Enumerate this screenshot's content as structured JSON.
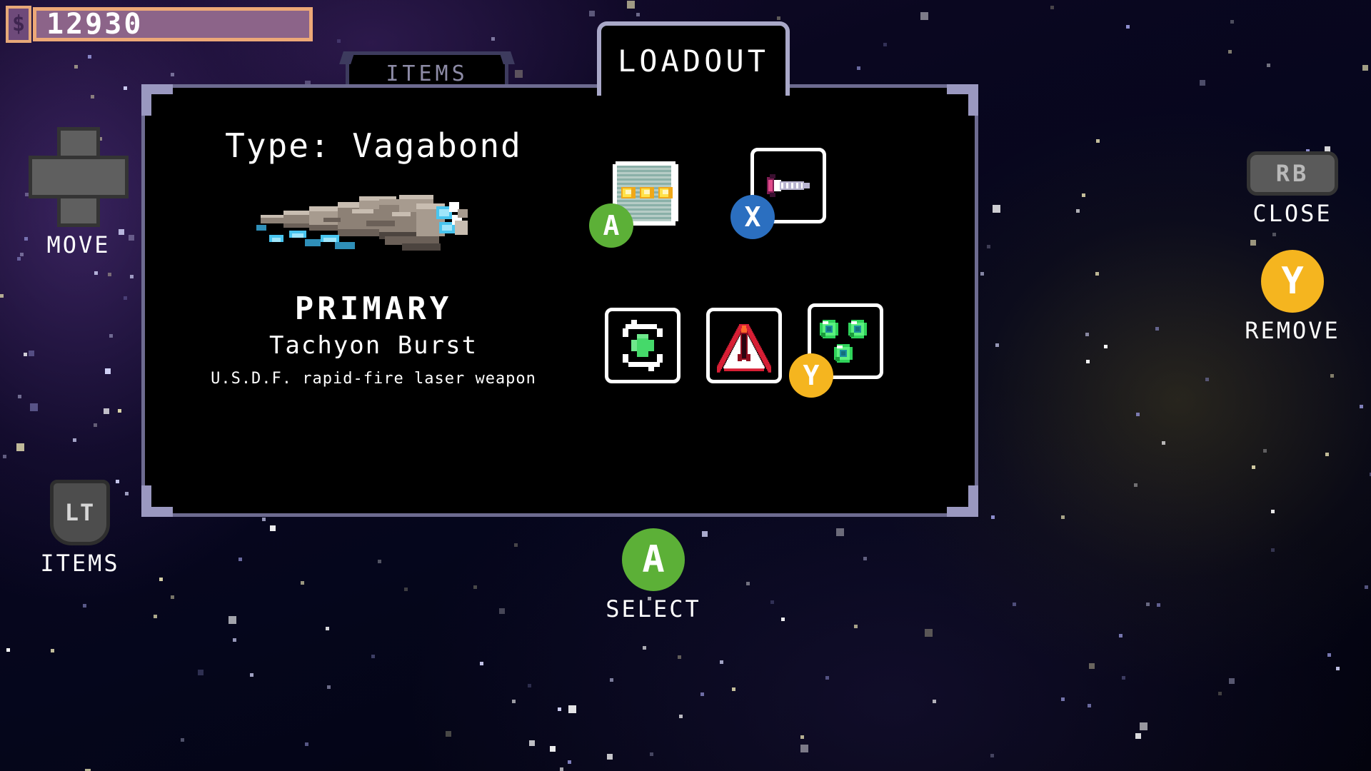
{
  "hud": {
    "currency": {
      "icon": "coin-icon",
      "symbol": "$",
      "value": "12930"
    }
  },
  "tabs": [
    {
      "id": "items",
      "label": "ITEMS",
      "active": false
    },
    {
      "id": "loadout",
      "label": "LOADOUT",
      "active": true
    }
  ],
  "panel": {
    "ship": {
      "type_line": "Type: Vagabond",
      "sprite": "vagabond-ship-sprite"
    },
    "primary": {
      "slot_label": "PRIMARY",
      "weapon_name": "Tachyon Burst",
      "description": "U.S.D.F. rapid-fire laser weapon"
    },
    "slots": [
      {
        "id": "slot-1",
        "icon": "ammo-crate-icon",
        "badge": "A",
        "badge_color": "#5cb037",
        "filled": true,
        "bordered": false
      },
      {
        "id": "slot-2",
        "icon": "ship-module-icon",
        "badge": "X",
        "badge_color": "#2b6fc0",
        "filled": true,
        "bordered": true
      },
      {
        "id": "slot-3",
        "icon": "repair-health-icon",
        "badge": "",
        "badge_color": "",
        "filled": true,
        "bordered": true
      },
      {
        "id": "slot-4",
        "icon": "missile-warning-icon",
        "badge": "",
        "badge_color": "",
        "filled": true,
        "bordered": true
      },
      {
        "id": "slot-5",
        "icon": "green-orbs-icon",
        "badge": "Y",
        "badge_color": "#f5b51f",
        "filled": true,
        "bordered": true
      }
    ]
  },
  "controls": {
    "move": {
      "button": "dpad-icon",
      "glyph": "",
      "label": "MOVE"
    },
    "items": {
      "button": "lt-trigger",
      "glyph": "LT",
      "label": "ITEMS"
    },
    "close": {
      "button": "rb-bumper",
      "glyph": "RB",
      "label": "CLOSE"
    },
    "remove": {
      "button": "y-button",
      "glyph": "Y",
      "label": "REMOVE"
    },
    "select": {
      "button": "a-button",
      "glyph": "A",
      "label": "SELECT"
    }
  },
  "colors": {
    "accent_green": "#5cb037",
    "accent_blue": "#2b6fc0",
    "accent_yellow": "#f5b51f",
    "panel_border": "#6d6b90",
    "tab_active_border": "#a9a8c8",
    "tab_inactive_text": "#8d8ba6",
    "currency_bar": "#8c6489",
    "currency_border": "#eda877"
  }
}
